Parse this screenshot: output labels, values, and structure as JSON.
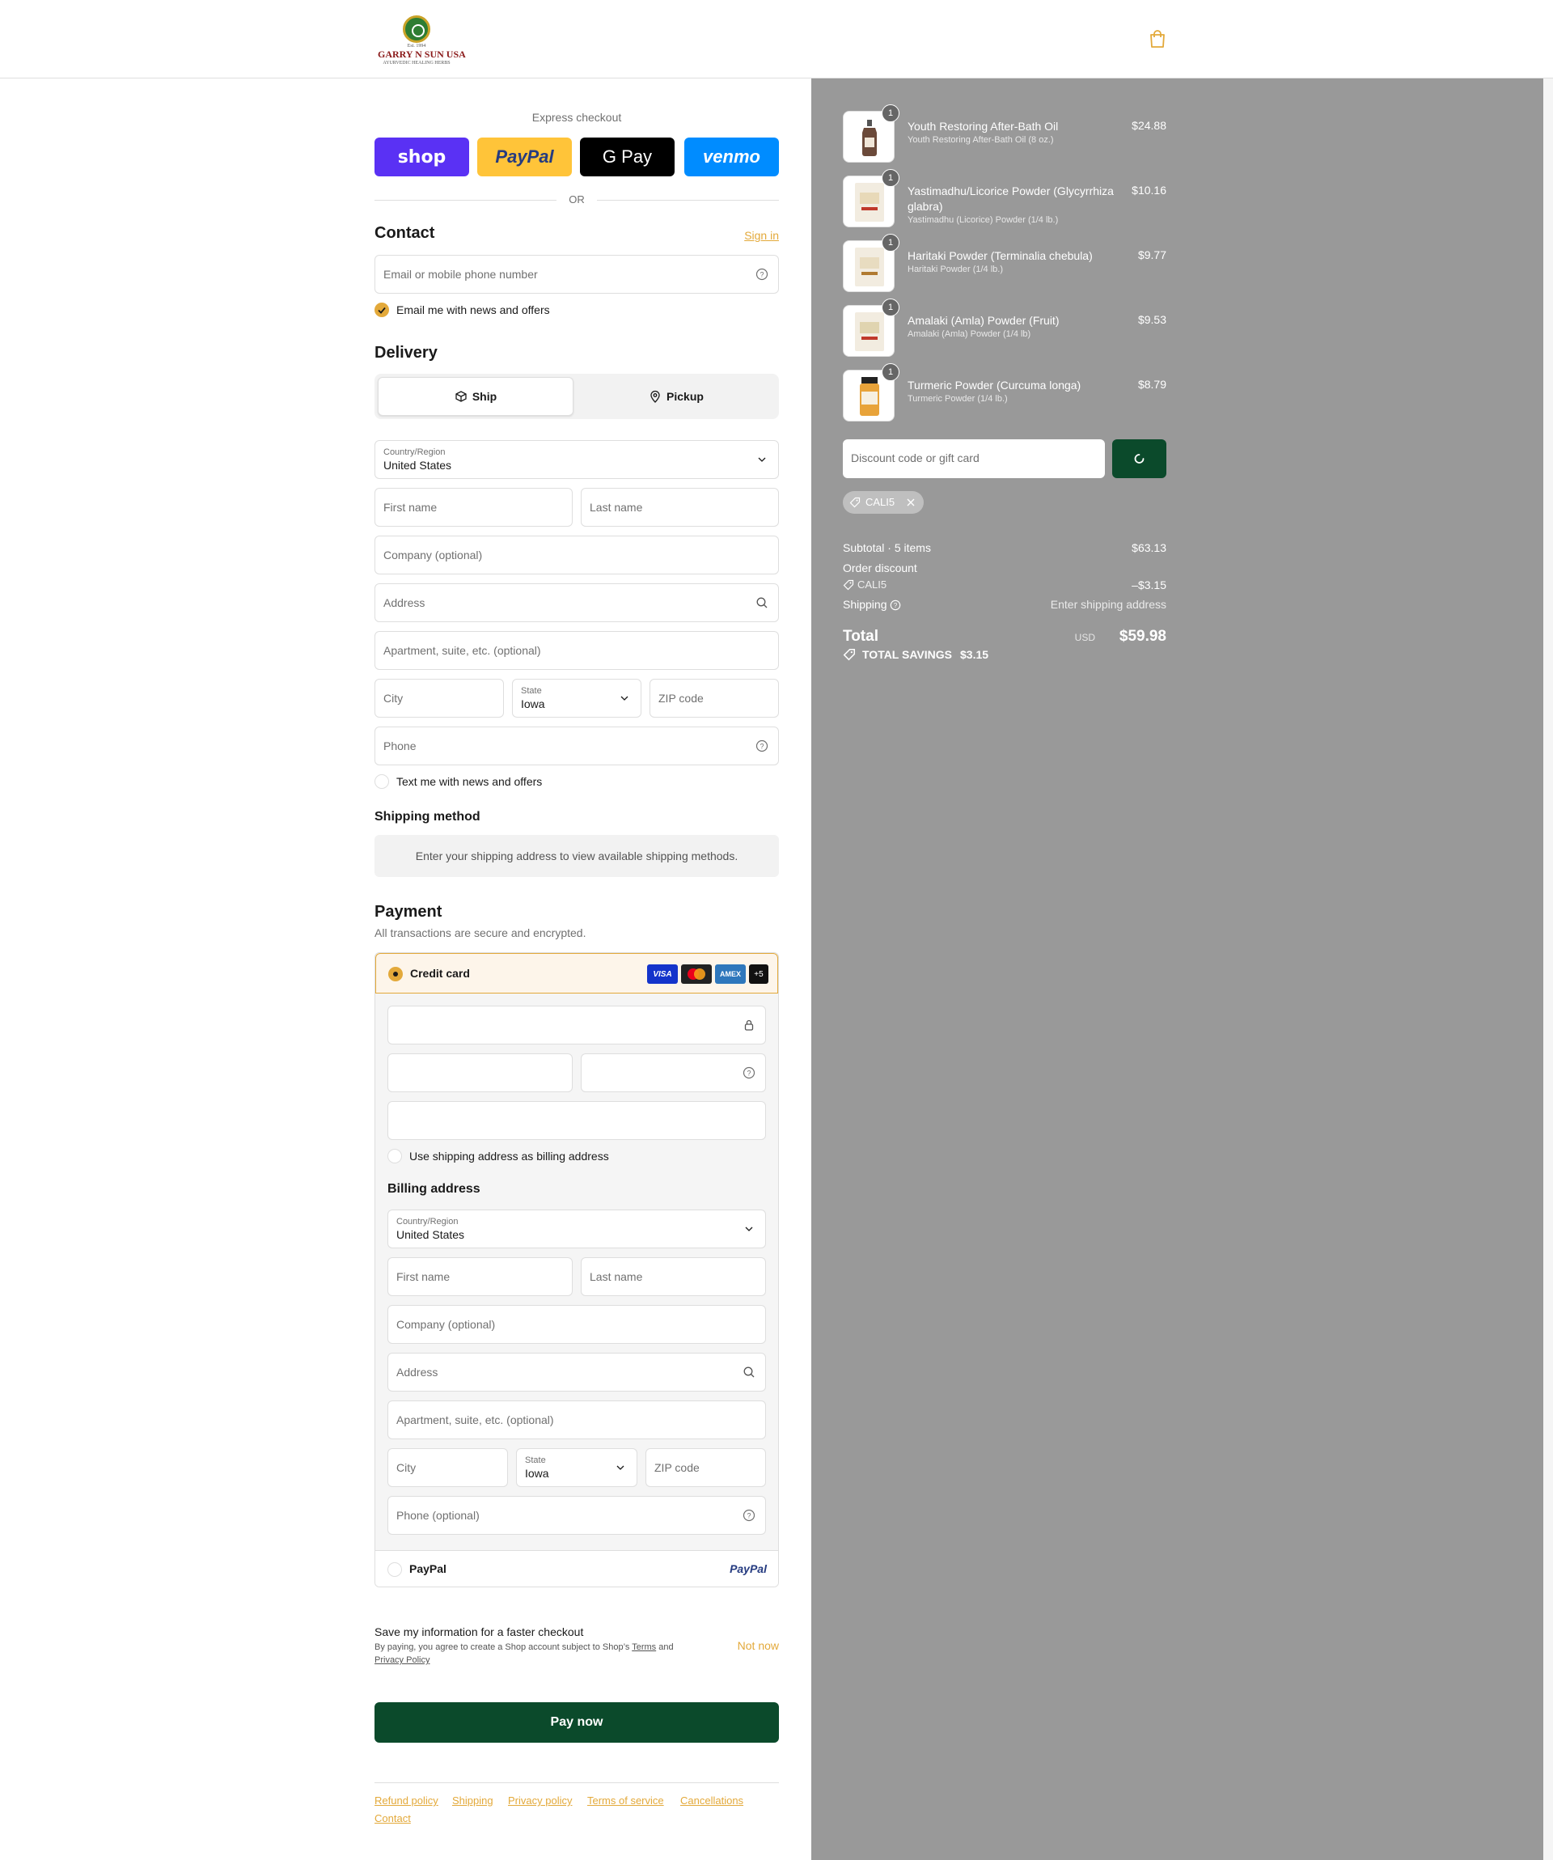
{
  "header": {
    "brand_top": "Est. 1994",
    "brand": "GARRY N SUN USA",
    "brand_tag": "AYURVEDIC HEALING HERBS"
  },
  "colors": {
    "accent": "#e3a93a",
    "primary_button": "#0b4a2b",
    "summary_bg": "#999999"
  },
  "express": {
    "label": "Express checkout",
    "buttons": [
      {
        "label": "shop",
        "bg": "#5a31f4"
      },
      {
        "label": "PayPal",
        "bg": "#ffc439"
      },
      {
        "label": "G Pay",
        "bg": "#000000"
      },
      {
        "label": "venmo",
        "bg": "#008cff"
      }
    ],
    "or": "OR"
  },
  "contact": {
    "title": "Contact",
    "sign_in": "Sign in",
    "email_placeholder": "Email or mobile phone number",
    "news_label": "Email me with news and offers"
  },
  "delivery": {
    "title": "Delivery",
    "ship_label": "Ship",
    "pickup_label": "Pickup",
    "country_label": "Country/Region",
    "country_value": "United States",
    "first_name": "First name",
    "last_name": "Last name",
    "company": "Company (optional)",
    "address": "Address",
    "apartment": "Apartment, suite, etc. (optional)",
    "city": "City",
    "state_label": "State",
    "state_value": "Iowa",
    "zip": "ZIP code",
    "phone": "Phone",
    "text_label": "Text me with news and offers"
  },
  "shipping_method": {
    "title": "Shipping method",
    "info": "Enter your shipping address to view available shipping methods."
  },
  "payment": {
    "title": "Payment",
    "subtitle": "All transactions are secure and encrypted.",
    "credit_card_label": "Credit card",
    "card_logos": [
      "VISA",
      "MC",
      "AMEX",
      "+5"
    ],
    "use_shipping_label": "Use shipping address as billing address",
    "billing_title": "Billing address",
    "billing": {
      "country_label": "Country/Region",
      "country_value": "United States",
      "first_name": "First name",
      "last_name": "Last name",
      "company": "Company (optional)",
      "address": "Address",
      "apartment": "Apartment, suite, etc. (optional)",
      "city": "City",
      "state_label": "State",
      "state_value": "Iowa",
      "zip": "ZIP code",
      "phone": "Phone (optional)"
    },
    "paypal_label": "PayPal",
    "paypal_logo": "PayPal"
  },
  "save_info": {
    "title": "Save my information for a faster checkout",
    "text_before": "By paying, you agree to create a Shop account subject to Shop’s",
    "terms": "Terms",
    "and": "and",
    "privacy": "Privacy Policy",
    "not_now": "Not now"
  },
  "pay_now": "Pay now",
  "footer_links": [
    "Refund policy",
    "Shipping",
    "Privacy policy",
    "Terms of service",
    "Cancellations",
    "Contact"
  ],
  "summary": {
    "items": [
      {
        "name": "Youth Restoring After-Bath Oil",
        "variant": "Youth Restoring After-Bath Oil (8 oz.)",
        "price": "$24.88",
        "qty": "1"
      },
      {
        "name": "Yastimadhu/Licorice Powder (Glycyrrhiza glabra)",
        "variant": "Yastimadhu (Licorice) Powder (1/4 lb.)",
        "price": "$10.16",
        "qty": "1"
      },
      {
        "name": "Haritaki Powder (Terminalia chebula)",
        "variant": "Haritaki Powder (1/4 lb.)",
        "price": "$9.77",
        "qty": "1"
      },
      {
        "name": "Amalaki (Amla) Powder (Fruit)",
        "variant": "Amalaki (Amla) Powder (1/4 lb)",
        "price": "$9.53",
        "qty": "1"
      },
      {
        "name": "Turmeric Powder (Curcuma longa)",
        "variant": "Turmeric Powder (1/4 lb.)",
        "price": "$8.79",
        "qty": "1"
      }
    ],
    "discount_placeholder": "Discount code or gift card",
    "applied_code": "CALI5",
    "subtotal_label": "Subtotal · 5 items",
    "subtotal_value": "$63.13",
    "order_discount_label": "Order discount",
    "discount_code": "CALI5",
    "discount_value": "–$3.15",
    "shipping_label": "Shipping",
    "shipping_value": "Enter shipping address",
    "total_label": "Total",
    "currency": "USD",
    "total_value": "$59.98",
    "savings_label": "TOTAL SAVINGS",
    "savings_value": "$3.15"
  }
}
